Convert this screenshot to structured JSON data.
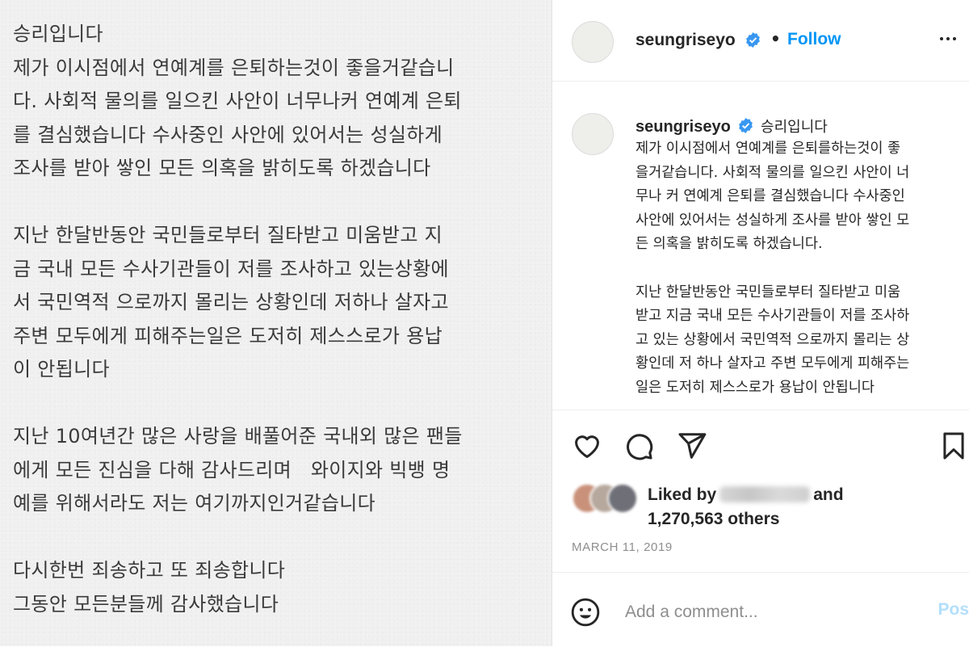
{
  "image_note": {
    "lines": [
      "승리입니다",
      "제가 이시점에서 연예계를 은퇴하는것이 좋을거같습니",
      "다. 사회적 물의를 일으킨 사안이 너무나커 연예계 은퇴",
      "를 결심했습니다 수사중인 사안에 있어서는 성실하게",
      "조사를 받아 쌓인 모든 의혹을 밝히도록 하겠습니다",
      "",
      "지난 한달반동안 국민들로부터 질타받고 미움받고 지",
      "금 국내 모든 수사기관들이 저를 조사하고 있는상황에",
      "서 국민역적 으로까지 몰리는 상황인데 저하나 살자고",
      "주변 모두에게 피해주는일은 도저히 제스스로가 용납",
      "이 안됩니다",
      "",
      "지난 10여년간 많은 사랑을 배풀어준 국내외 많은 팬들",
      "에게 모든 진심을 다해 감사드리며   와이지와 빅뱅 명",
      "예를 위해서라도 저는 여기까지인거같습니다",
      "",
      "다시한번 죄송하고 또 죄송합니다",
      "그동안 모든분들께 감사했습니다"
    ]
  },
  "header": {
    "username": "seungriseyo",
    "separator": "•",
    "follow_label": "Follow"
  },
  "caption": {
    "username": "seungriseyo",
    "first_line": "승리입니다",
    "lines": [
      "제가 이시점에서 연예계를 은퇴를하는것이 좋",
      "을거같습니다. 사회적 물의를 일으킨 사안이 너",
      "무나 커 연예계 은퇴를 결심했습니다 수사중인",
      "사안에 있어서는 성실하게 조사를 받아 쌓인 모",
      "든 의혹을 밝히도록 하겠습니다.",
      "",
      "지난 한달반동안 국민들로부터 질타받고 미움",
      "받고 지금 국내 모든 수사기관들이 저를 조사하",
      "고 있는 상황에서 국민역적 으로까지 몰리는 상",
      "황인데 저 하나 살자고 주변 모두에게 피해주는",
      "일은 도저히 제스스로가 용납이 안됩니다"
    ]
  },
  "actions": {
    "icons": [
      "heart-icon",
      "comment-icon",
      "share-icon",
      "bookmark-icon"
    ]
  },
  "likes": {
    "prefix": "Liked by",
    "conjunction": "and",
    "others": "1,270,563 others"
  },
  "post_date": "MARCH 11, 2019",
  "comment_box": {
    "placeholder": "Add a comment...",
    "post_label": "Post"
  },
  "colors": {
    "link_blue": "#0095f6",
    "post_disabled": "#b2dffc",
    "verified_blue": "#3897f0",
    "muted_text": "#8e8e8e"
  }
}
